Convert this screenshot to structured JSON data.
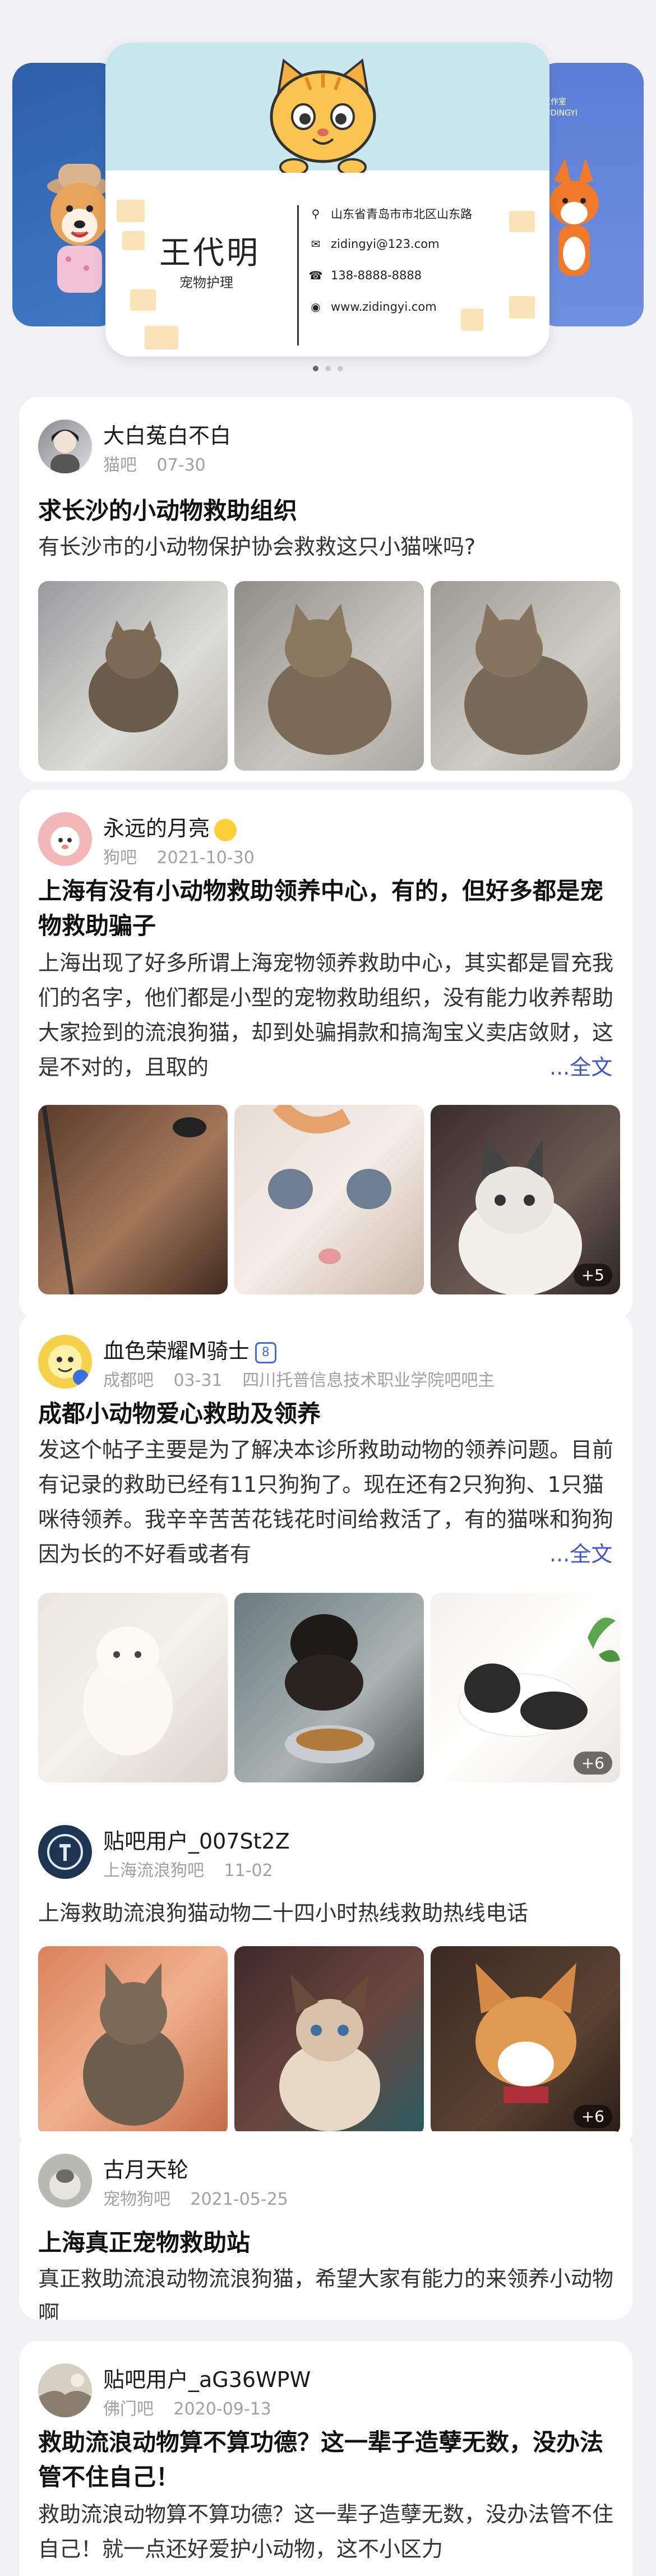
{
  "banner": {
    "right_card_tag": "工作室",
    "right_card_sub": "ZIDINGYI",
    "name": "王代明",
    "role": "宠物护理",
    "contacts": [
      {
        "icon": "location-icon",
        "text": "山东省青岛市市北区山东路"
      },
      {
        "icon": "mail-icon",
        "text": "zidingyi@123.com"
      },
      {
        "icon": "phone-icon",
        "text": "138-8888-8888"
      },
      {
        "icon": "globe-icon",
        "text": "www.zidingyi.com"
      }
    ],
    "page_dots": 3,
    "active_dot": 1
  },
  "posts": [
    {
      "user": "大白菟白不白",
      "forum": "猫吧",
      "date": "07-30",
      "title": "求长沙的小动物救助组织",
      "content": "有长沙市的小动物保护协会救救这只小猫咪吗?",
      "image_count_badge": ""
    },
    {
      "user": "永远的月亮",
      "forum": "狗吧",
      "date": "2021-10-30",
      "title": "上海有没有小动物救助领养中心，有的，但好多都是宠物救助骗子",
      "content": "上海出现了好多所谓上海宠物领养救助中心，其实都是冒充我们的名字，他们都是小型的宠物救助组织，没有能力收养帮助大家捡到的流浪狗猫，却到处骗捐款和搞淘宝义卖店敛财，这是不对的，且取的",
      "more": "...全文",
      "image_count_badge": "+5"
    },
    {
      "user": "血色荣耀M骑士",
      "level": "8",
      "forum": "成都吧",
      "date": "03-31",
      "extra": "四川托普信息技术职业学院吧吧主",
      "title": "成都小动物爱心救助及领养",
      "content": "发这个帖子主要是为了解决本诊所救助动物的领养问题。目前有记录的救助已经有11只狗狗了。现在还有2只狗狗、1只猫咪待领养。我辛辛苦苦花钱花时间给救活了，有的猫咪和狗狗因为长的不好看或者有",
      "more": "...全文",
      "image_count_badge": "+6"
    },
    {
      "user": "贴吧用户_007St2Z",
      "forum": "上海流浪狗吧",
      "date": "11-02",
      "title": "",
      "content": "上海救助流浪狗猫动物二十四小时热线救助热线电话",
      "image_count_badge": "+6"
    },
    {
      "user": "古月天轮",
      "forum": "宠物狗吧",
      "date": "2021-05-25",
      "title": "上海真正宠物救助站",
      "content": "真正救助流浪动物流浪狗猫，希望大家有能力的来领养小动物啊",
      "image_count_badge": ""
    },
    {
      "user": "贴吧用户_aG36WPW",
      "forum": "佛门吧",
      "date": "2020-09-13",
      "title": "救助流浪动物算不算功德？这一辈子造孽无数，没办法管不住自己！",
      "content": "救助流浪动物算不算功德？这一辈子造孽无数，没办法管不住自己！就一点还好爱护小动物，这不小区力",
      "image_count_badge": ""
    }
  ]
}
